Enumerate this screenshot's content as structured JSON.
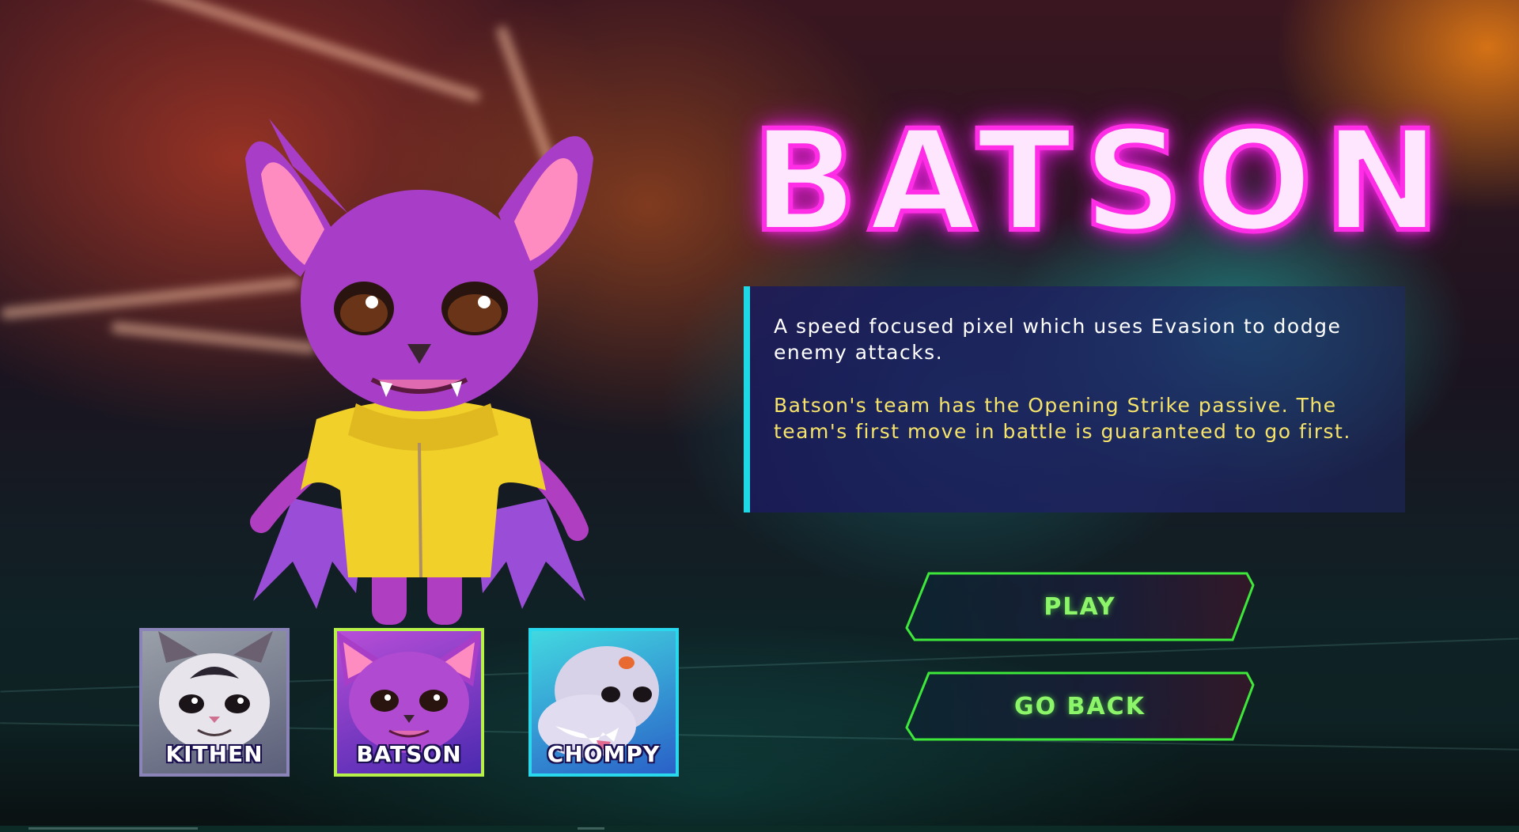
{
  "character": {
    "name": "BATSON",
    "description": "A speed focused pixel which uses Evasion to dodge enemy attacks.",
    "passive": "Batson's team has the Opening Strike passive. The team's first move in battle is guaranteed to go first."
  },
  "buttons": {
    "play": "PLAY",
    "go_back": "GO BACK"
  },
  "roster": [
    {
      "name": "KITHEN"
    },
    {
      "name": "BATSON"
    },
    {
      "name": "CHOMPY"
    }
  ],
  "colors": {
    "title_glow": "#ff2ee6",
    "panel_accent": "#1ed8e6",
    "passive_text": "#f6e36a",
    "button_text": "#8df56a",
    "button_border": "#3ee83a",
    "selected_card_border": "#b8f04a"
  }
}
